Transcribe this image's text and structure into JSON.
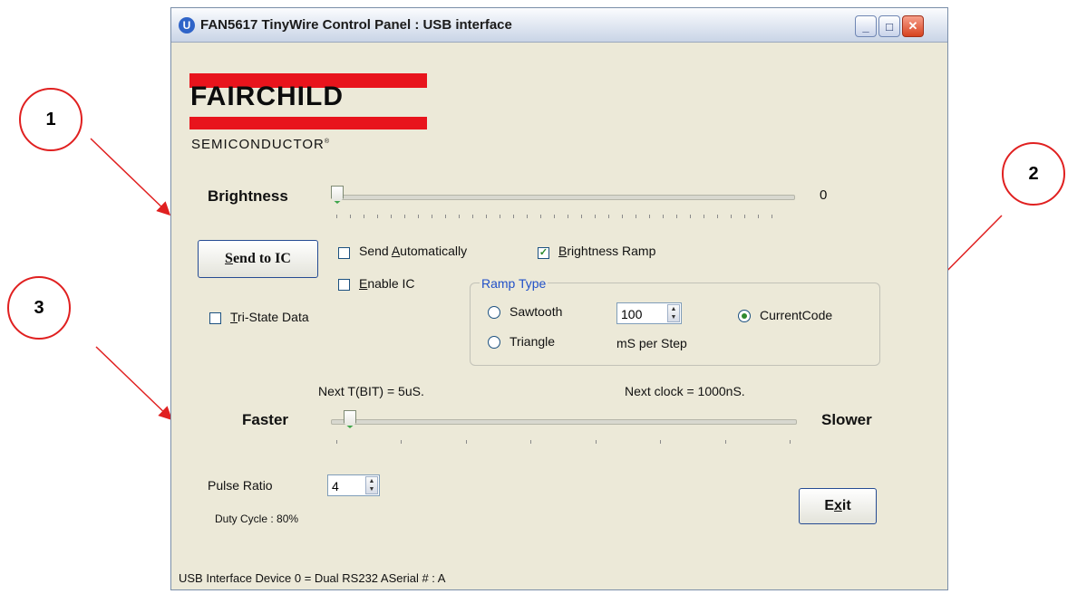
{
  "callouts": [
    "1",
    "2",
    "3"
  ],
  "window": {
    "title": "FAN5617 TinyWire Control Panel : USB interface",
    "icon": "power-icon",
    "controls": [
      "minimize-icon",
      "maximize-icon",
      "close-icon"
    ]
  },
  "logo": {
    "word": "FAIRCHILD",
    "sub": "SEMICONDUCTOR",
    "colors": {
      "bar": "#e8141c"
    }
  },
  "brightness": {
    "label": "Brightness",
    "value": "0",
    "level": 0
  },
  "send_button": {
    "label_first": "S",
    "label_rest": "end to IC"
  },
  "checkboxes": {
    "send_auto": {
      "pre": "Send ",
      "ul": "A",
      "post": "utomatically",
      "checked": false
    },
    "brightness_ramp": {
      "pre": "",
      "ul": "B",
      "post": "rightness Ramp",
      "checked": true
    },
    "enable_ic": {
      "pre": "",
      "ul": "E",
      "post": "nable IC",
      "checked": false
    },
    "tri_state": {
      "pre": "",
      "ul": "T",
      "post": "ri-State Data",
      "checked": false
    }
  },
  "ramp": {
    "title": "Ramp Type",
    "sawtooth": "Sawtooth",
    "triangle": "Triangle",
    "step_value": "100",
    "step_unit": "mS per Step",
    "current_code": "CurrentCode",
    "selected": "CurrentCode"
  },
  "speed": {
    "next_tbit": "Next T(BIT) = 5uS.",
    "next_clock": "Next clock =  1000nS.",
    "faster": "Faster",
    "slower": "Slower"
  },
  "pulse": {
    "label": "Pulse Ratio",
    "value": "4",
    "duty": "Duty Cycle :  80%"
  },
  "exit_button": {
    "pre": "E",
    "ul": "x",
    "post": "it"
  },
  "status_bar": "USB Interface Device 0 = Dual RS232 ASerial # : A",
  "colors": {
    "accent": "#2050c8",
    "callout": "#e02020"
  }
}
